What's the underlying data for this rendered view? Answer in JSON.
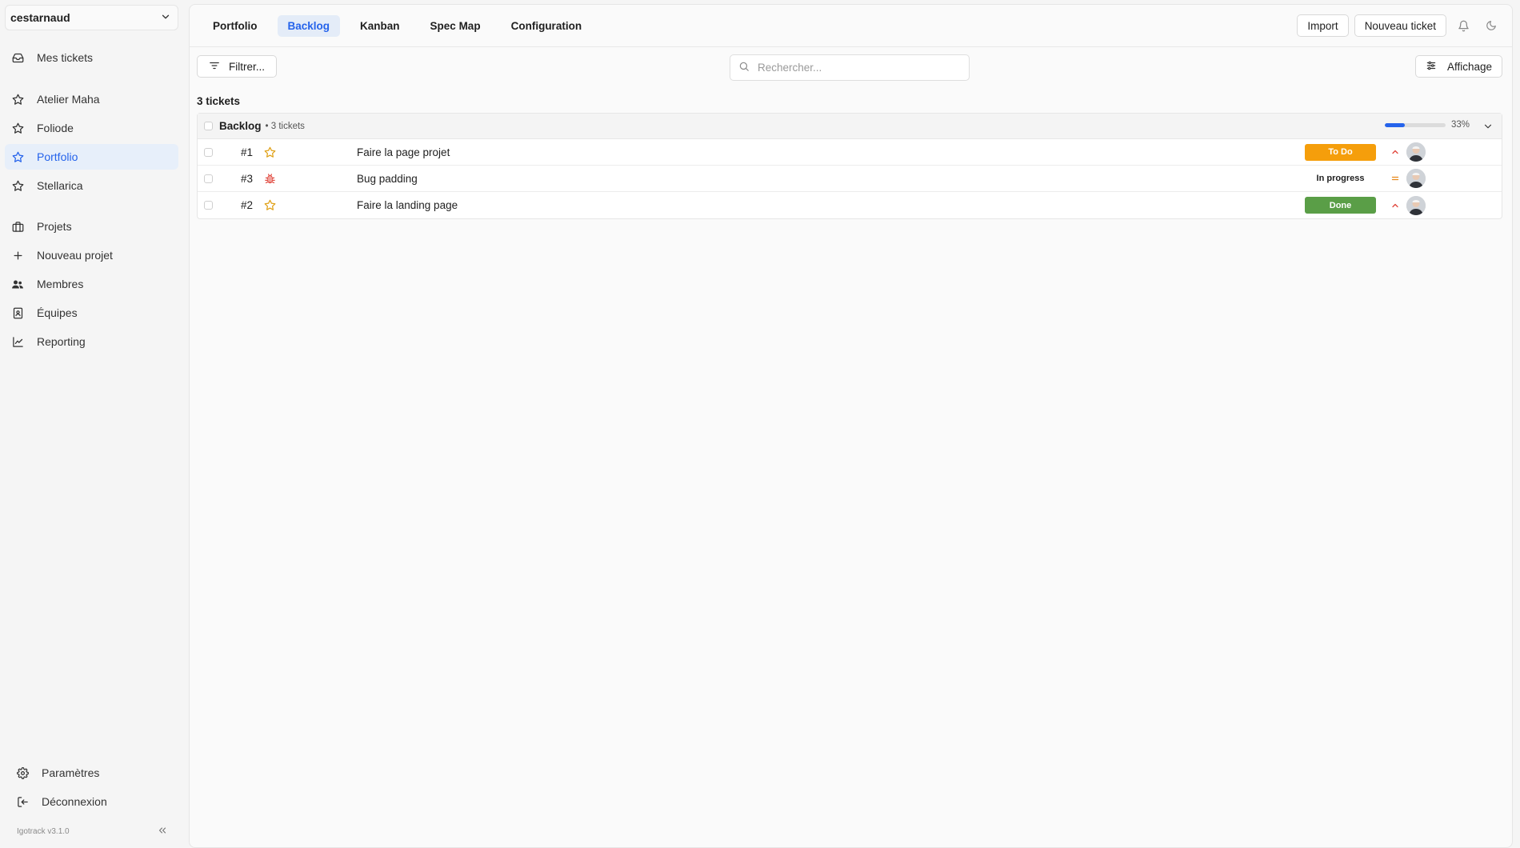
{
  "sidebar": {
    "workspace": "cestarnaud",
    "items_top": [
      {
        "label": "Mes tickets",
        "icon": "inbox-icon"
      }
    ],
    "favorites": [
      {
        "label": "Atelier Maha",
        "icon": "star-icon",
        "active": false
      },
      {
        "label": "Foliode",
        "icon": "star-icon",
        "active": false
      },
      {
        "label": "Portfolio",
        "icon": "star-icon",
        "active": true
      },
      {
        "label": "Stellarica",
        "icon": "star-icon",
        "active": false
      }
    ],
    "admin": [
      {
        "label": "Projets",
        "icon": "briefcase-icon"
      },
      {
        "label": "Nouveau projet",
        "icon": "plus-icon"
      },
      {
        "label": "Membres",
        "icon": "users-icon"
      },
      {
        "label": "Équipes",
        "icon": "contacts-book-icon"
      },
      {
        "label": "Reporting",
        "icon": "line-chart-icon"
      }
    ],
    "bottom": [
      {
        "label": "Paramètres",
        "icon": "gear-icon"
      },
      {
        "label": "Déconnexion",
        "icon": "logout-icon"
      }
    ],
    "version": "Igotrack v3.1.0"
  },
  "header": {
    "tabs": [
      {
        "label": "Portfolio",
        "active": false
      },
      {
        "label": "Backlog",
        "active": true
      },
      {
        "label": "Kanban",
        "active": false
      },
      {
        "label": "Spec Map",
        "active": false
      },
      {
        "label": "Configuration",
        "active": false
      }
    ],
    "import_label": "Import",
    "new_ticket_label": "Nouveau ticket"
  },
  "toolbar": {
    "filter_label": "Filtrer...",
    "search_placeholder": "Rechercher...",
    "display_label": "Affichage"
  },
  "ticket_count": "3 tickets",
  "group": {
    "title": "Backlog",
    "subtitle": "• 3 tickets",
    "progress_percent_label": "33%",
    "progress_fraction": 0.33
  },
  "tickets": [
    {
      "number": "#1",
      "type": "story",
      "title": "Faire la page projet",
      "status": "To Do",
      "priority": "high"
    },
    {
      "number": "#3",
      "type": "bug",
      "title": "Bug padding",
      "status": "In progress",
      "priority": "medium"
    },
    {
      "number": "#2",
      "type": "story",
      "title": "Faire la landing page",
      "status": "Done",
      "priority": "high"
    }
  ],
  "colors": {
    "accent": "#2563eb",
    "todo": "#f59e0b",
    "done": "#5a9e47",
    "priority_high": "#e0453b",
    "priority_medium": "#e8891a",
    "star": "#e0a21a",
    "bug": "#e0453b"
  }
}
